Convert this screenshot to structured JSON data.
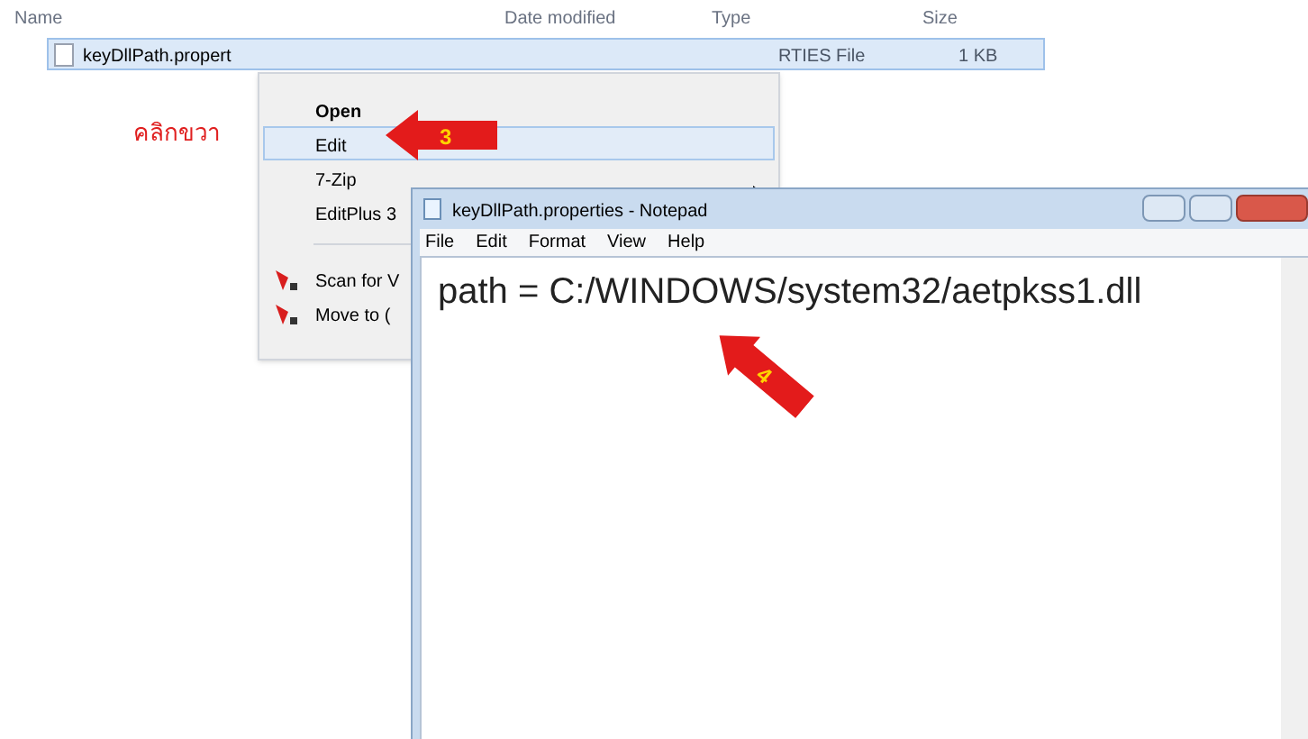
{
  "explorer": {
    "columns": [
      "Name",
      "Date modified",
      "Type",
      "Size"
    ],
    "file": {
      "name": "keyDllPath.propert",
      "type": "RTIES File",
      "size": "1 KB",
      "selected": true
    }
  },
  "annotation": {
    "text": "คลิกขวา"
  },
  "context_menu": {
    "items": [
      {
        "kind": "item",
        "label": "Open",
        "bold": true,
        "selected": false
      },
      {
        "kind": "item",
        "label": "Edit",
        "bold": false,
        "selected": true
      },
      {
        "kind": "submenu",
        "label": "7-Zip",
        "bold": false,
        "selected": false
      },
      {
        "kind": "item",
        "label": "EditPlus 3",
        "bold": false,
        "selected": false
      },
      {
        "kind": "separator"
      },
      {
        "kind": "scan",
        "label": "Scan for V",
        "bold": false,
        "selected": false
      },
      {
        "kind": "scan",
        "label": "Move to (",
        "bold": false,
        "selected": false
      }
    ]
  },
  "callouts": [
    {
      "label": "3"
    },
    {
      "label": "4"
    }
  ],
  "notepad": {
    "title": "keyDllPath.properties - Notepad",
    "menu": [
      "File",
      "Edit",
      "Format",
      "View",
      "Help"
    ],
    "content": "path = C:/WINDOWS/system32/aetpkss1.dll"
  }
}
